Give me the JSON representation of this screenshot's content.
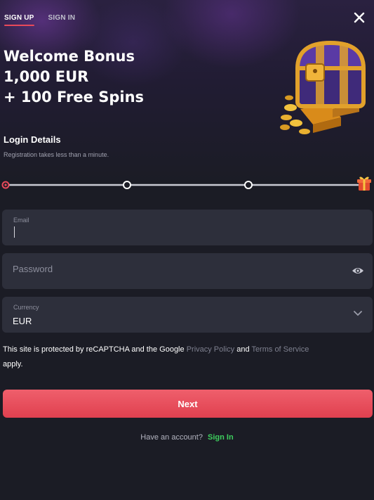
{
  "tabs": {
    "sign_up": "SIGN UP",
    "sign_in": "SIGN IN"
  },
  "bonus": {
    "line1": "Welcome Bonus",
    "line2": "1,000 EUR",
    "line3": "+ 100 Free Spins"
  },
  "section": {
    "title": "Login Details",
    "subtitle": "Registration takes less than a minute."
  },
  "progress": {
    "current_step": 1,
    "steps": 4
  },
  "form": {
    "email_label": "Email",
    "password_placeholder": "Password",
    "currency_label": "Currency",
    "currency_value": "EUR"
  },
  "notice": {
    "prefix": "This site is protected by reCAPTCHA and the Google",
    "privacy_link": "Privacy Policy",
    "and": "and",
    "terms_link": "Terms of Service",
    "suffix": "apply."
  },
  "next_button": "Next",
  "footer": {
    "have_account": "Have an account?",
    "sign_in_link": "Sign In"
  },
  "colors": {
    "accent": "#e8495a",
    "button": "#e34a58",
    "field": "#2d2f3b",
    "background": "#1b1c25",
    "sign_in_link": "#3ecf5e"
  },
  "icons": [
    "close-icon",
    "treasure-chest-icon",
    "gift-icon",
    "eye-icon",
    "chevron-down-icon"
  ]
}
